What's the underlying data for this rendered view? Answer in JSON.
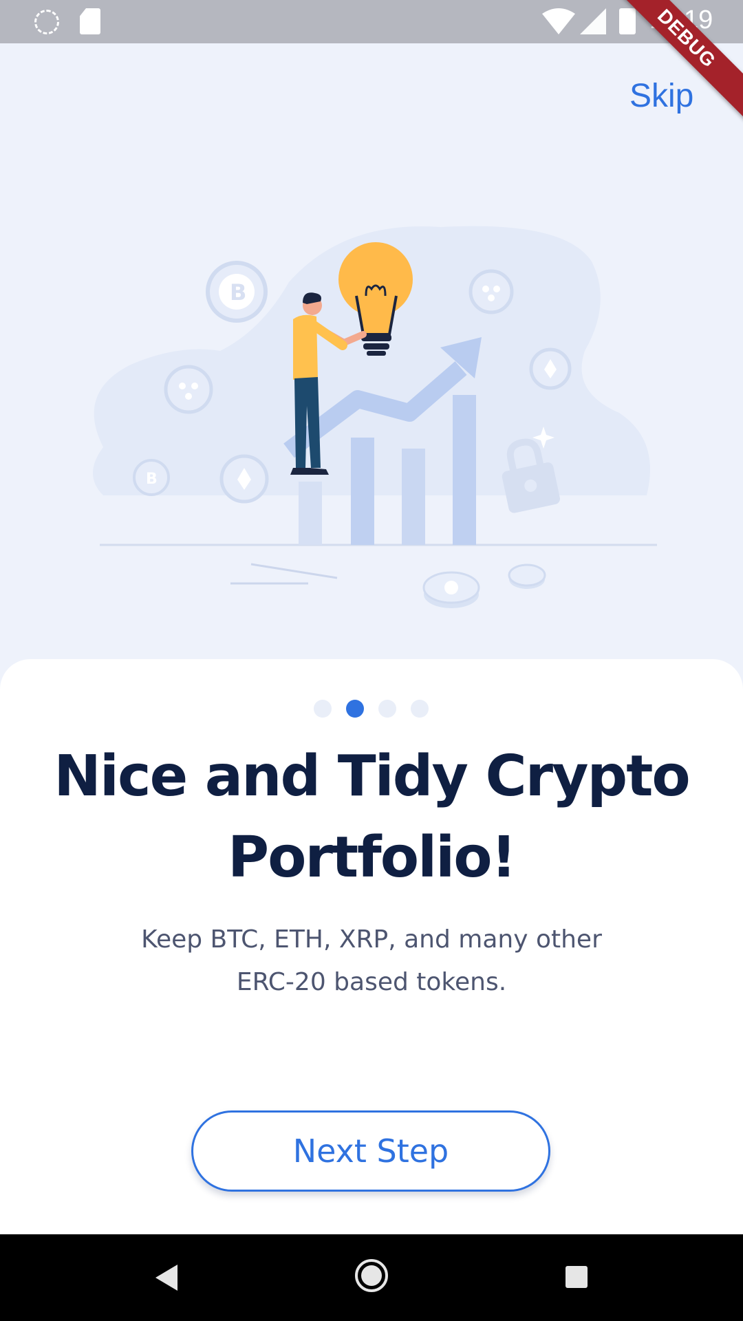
{
  "status_bar": {
    "time": "11:19",
    "debug_label": "DEBUG",
    "icons": [
      "loading-icon",
      "sd-card-icon",
      "wifi-icon",
      "signal-icon",
      "battery-icon"
    ]
  },
  "header": {
    "skip_label": "Skip"
  },
  "illustration": {
    "description_icons": [
      "bitcoin-coin-icon",
      "ripple-coin-icon",
      "ethereum-coin-icon",
      "lightbulb-icon",
      "padlock-icon",
      "trend-arrow-icon"
    ]
  },
  "onboarding": {
    "total_pages": 4,
    "current_page": 2,
    "title_line1": "Nice and Tidy Crypto",
    "title_line2": "Portfolio!",
    "subtitle_line1": "Keep BTC, ETH, XRP, and many other",
    "subtitle_line2": "ERC-20 based tokens.",
    "next_label": "Next Step"
  },
  "colors": {
    "accent": "#2F72E0",
    "title": "#0F1F42",
    "subtitle": "#4D5570",
    "background": "#EEF2FB",
    "card": "#FFFFFF",
    "dot_inactive": "#E9EEF8",
    "bulb": "#FFBA4A"
  },
  "nav_bar": {
    "icons": [
      "back-icon",
      "home-icon",
      "recents-icon"
    ]
  }
}
